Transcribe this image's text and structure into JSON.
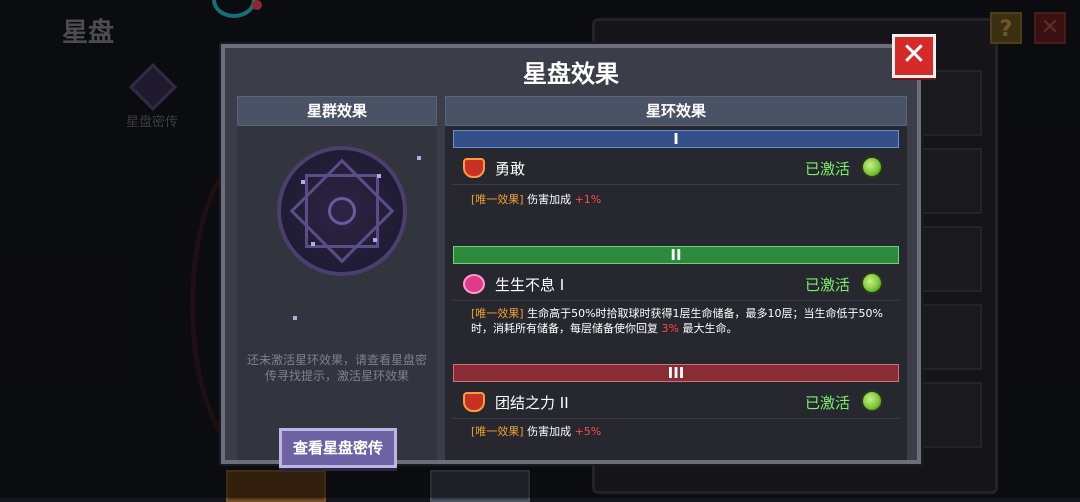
{
  "background": {
    "title": "星盘",
    "icon_label": "星盘密传",
    "help_label": "?",
    "close_label": "✕"
  },
  "modal": {
    "title": "星盘效果",
    "close_label": "✕",
    "left": {
      "header": "星群效果",
      "hint_line1": "还未激活星环效果，请查看星盘密",
      "hint_line2": "传寻找提示，激活星环效果",
      "button_label": "查看星盘密传"
    },
    "right": {
      "header": "星环效果",
      "tiers": [
        {
          "label": "I",
          "color": "#34508a",
          "effect": {
            "icon": "red-crest-icon",
            "name": "勇敢",
            "status": "已激活",
            "tag": "[唯一效果]",
            "desc_main": "伤害加成",
            "desc_value": "+1%"
          }
        },
        {
          "label": "II",
          "color": "#2c8a3c",
          "effect": {
            "icon": "pink-flower-icon",
            "name": "生生不息 I",
            "status": "已激活",
            "tag": "[唯一效果]",
            "desc_main": "生命高于50%时拾取球时获得1层生命储备，最多10层；当生命低于50%时，消耗所有储备，每层储备使你回复",
            "desc_value": "3%",
            "desc_tail": "最大生命。"
          }
        },
        {
          "label": "III",
          "color": "#8a2c36",
          "effect": {
            "icon": "red-crest-icon",
            "name": "团结之力 II",
            "status": "已激活",
            "tag": "[唯一效果]",
            "desc_main": "伤害加成",
            "desc_value": "+5%"
          }
        }
      ]
    }
  }
}
